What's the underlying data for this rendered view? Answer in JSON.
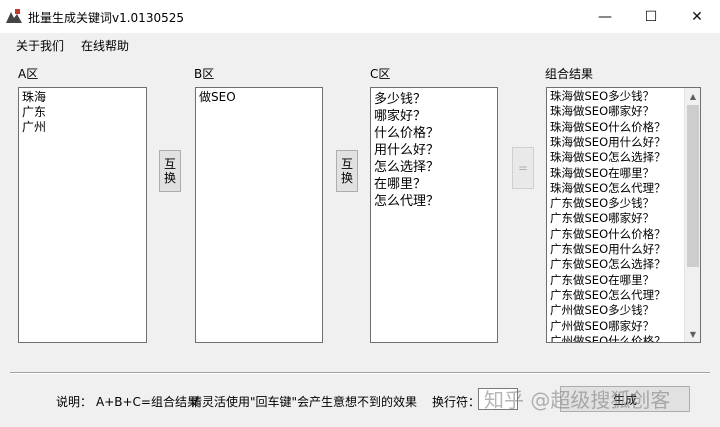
{
  "window": {
    "title": "批量生成关键词v1.0130525",
    "minimize": "—",
    "maximize": "☐",
    "close": "✕"
  },
  "menu": {
    "items": [
      "关于我们",
      "在线帮助"
    ]
  },
  "groups": {
    "a": {
      "label": "A区",
      "items": [
        "珠海",
        "广东",
        "广州"
      ]
    },
    "b": {
      "label": "B区",
      "items": [
        "做SEO"
      ]
    },
    "c": {
      "label": "C区",
      "items": [
        "多少钱？",
        "哪家好？",
        "什么价格？",
        "用什么好？",
        "怎么选择？",
        "在哪里？",
        "怎么代理？"
      ]
    },
    "result": {
      "label": "组合结果",
      "items": [
        "珠海做SEO多少钱？",
        "珠海做SEO哪家好？",
        "珠海做SEO什么价格？",
        "珠海做SEO用什么好？",
        "珠海做SEO怎么选择？",
        "珠海做SEO在哪里？",
        "珠海做SEO怎么代理？",
        "广东做SEO多少钱？",
        "广东做SEO哪家好？",
        "广东做SEO什么价格？",
        "广东做SEO用什么好？",
        "广东做SEO怎么选择？",
        "广东做SEO在哪里？",
        "广东做SEO怎么代理？",
        "广州做SEO多少钱？",
        "广州做SEO哪家好？",
        "广州做SEO什么价格？"
      ]
    }
  },
  "buttons": {
    "swap1": [
      "互",
      "换"
    ],
    "swap2": [
      "互",
      "换"
    ],
    "combine": "=",
    "generate": "生成"
  },
  "scrollbar": {
    "up": "▲",
    "down": "▼"
  },
  "status": {
    "explain": "说明：",
    "formula": "A+B+C=组合结果",
    "tip": "请灵活使用\"回车键\"会产生意想不到的效果",
    "separator_label": "换行符："
  },
  "watermark": "知乎 @超级搜狐创客"
}
